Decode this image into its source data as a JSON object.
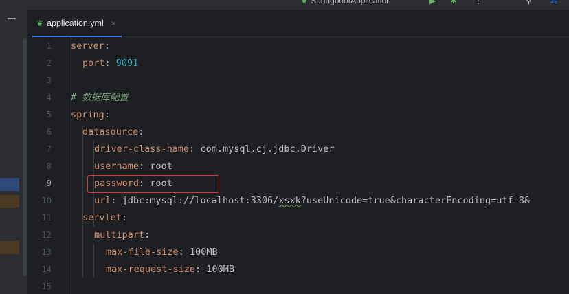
{
  "topbar": {
    "run_config": "SpringbootApplication"
  },
  "tab": {
    "filename": "application.yml",
    "close_glyph": "×",
    "icon": "spring-leaf-icon"
  },
  "editor": {
    "current_line": 9,
    "line_numbers": [
      "1",
      "2",
      "3",
      "4",
      "5",
      "6",
      "7",
      "8",
      "9",
      "10",
      "11",
      "12",
      "13",
      "14",
      "15"
    ],
    "lines": [
      {
        "key": "server",
        "sep": ":",
        "value": ""
      },
      {
        "key": "port",
        "sep": ": ",
        "value": "9091"
      },
      {
        "key": "",
        "sep": "",
        "value": ""
      },
      {
        "comment": "# 数据库配置"
      },
      {
        "key": "spring",
        "sep": ":",
        "value": ""
      },
      {
        "key": "datasource",
        "sep": ":",
        "value": ""
      },
      {
        "key": "driver-class-name",
        "sep": ": ",
        "value": "com.mysql.cj.jdbc.Driver"
      },
      {
        "key": "username",
        "sep": ": ",
        "value": "root"
      },
      {
        "key": "password",
        "sep": ": ",
        "value": "root"
      },
      {
        "key": "url",
        "sep": ": ",
        "value_a": "jdbc:mysql://localhost:3306/",
        "value_u": "xsxk",
        "value_b": "?useUnicode=true&characterEncoding=utf-8&"
      },
      {
        "key": "servlet",
        "sep": ":",
        "value": ""
      },
      {
        "key": "multipart",
        "sep": ":",
        "value": ""
      },
      {
        "key": "max-file-size",
        "sep": ": ",
        "value": "100MB"
      },
      {
        "key": "max-request-size",
        "sep": ": ",
        "value": "100MB"
      },
      {
        "key": "",
        "sep": "",
        "value": ""
      }
    ]
  },
  "colors": {
    "background": "#1e1f22",
    "key": "#cf8e6d",
    "number": "#2aacb8",
    "comment": "#7a9e7e",
    "highlight_border": "#d8373c",
    "accent": "#3574f0"
  }
}
